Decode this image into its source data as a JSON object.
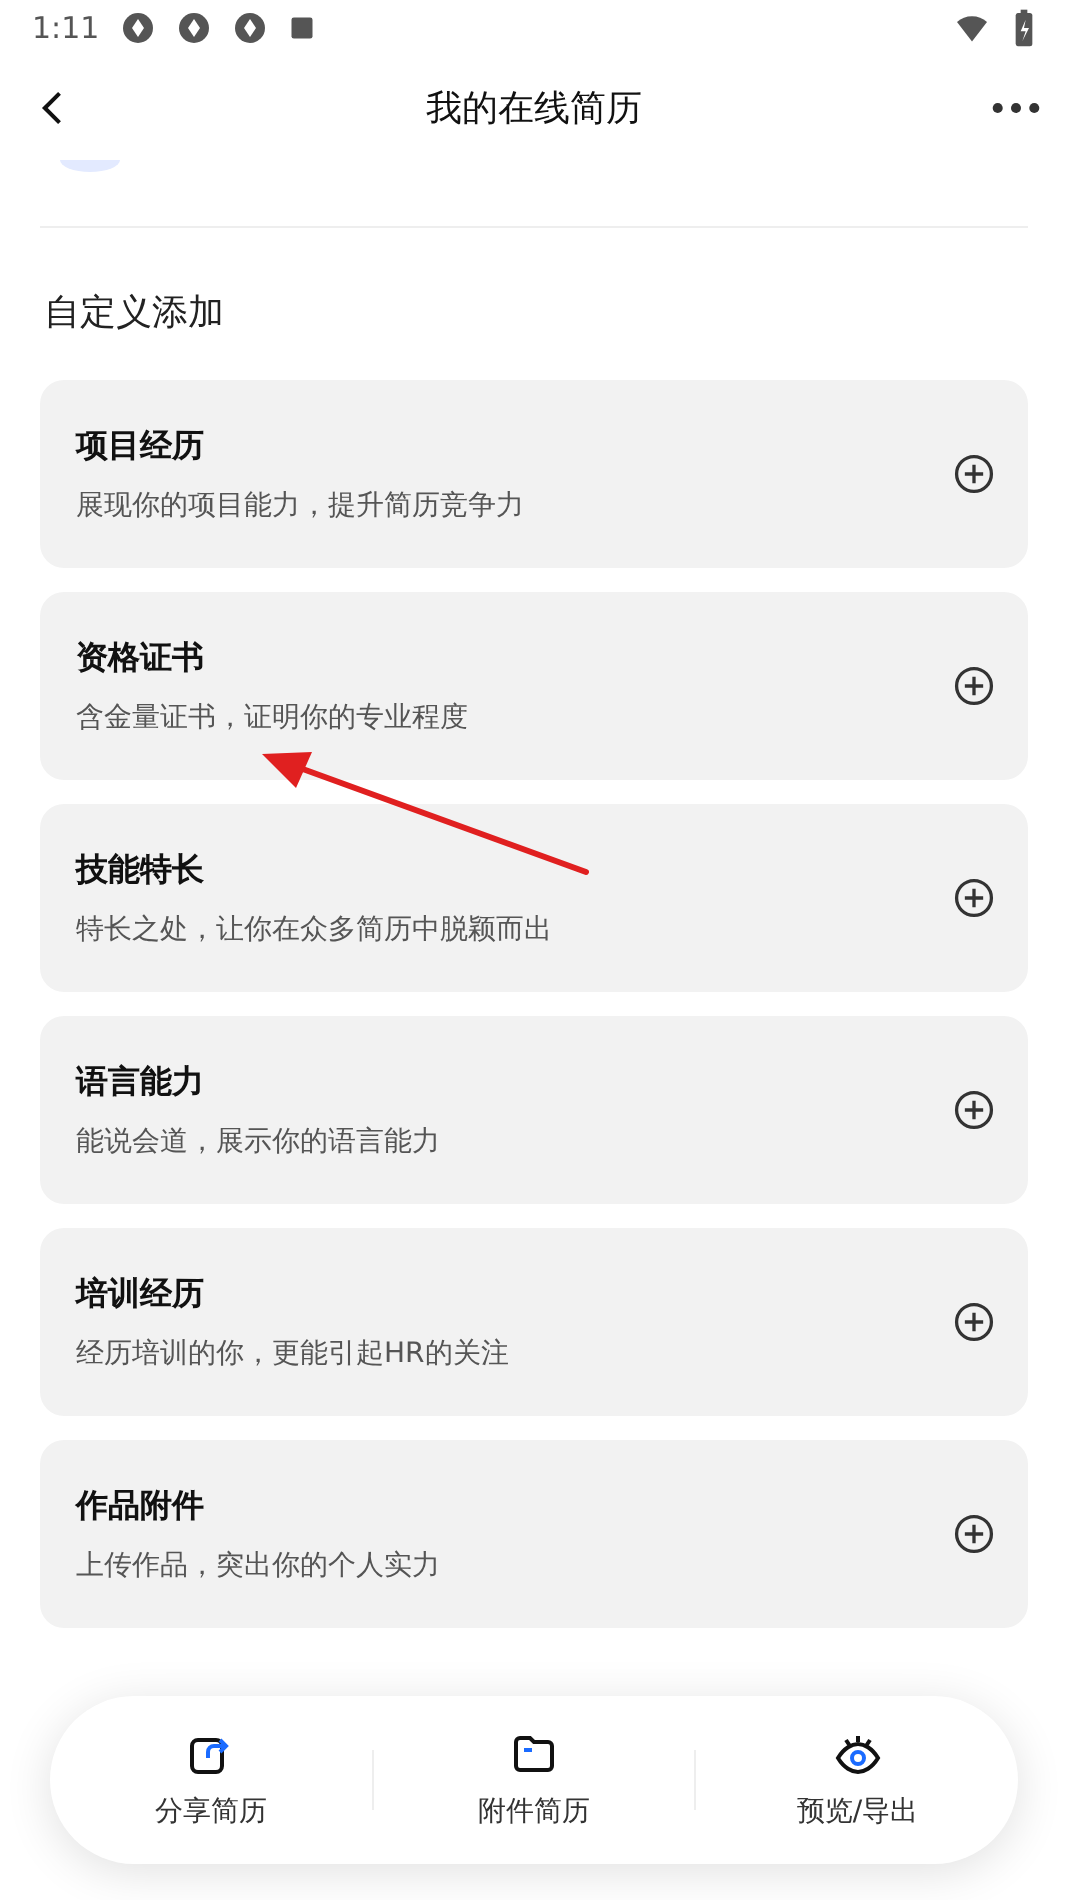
{
  "status_bar": {
    "time": "1:11"
  },
  "header": {
    "title": "我的在线简历"
  },
  "section": {
    "title": "自定义添加"
  },
  "items": [
    {
      "title": "项目经历",
      "subtitle": "展现你的项目能力，提升简历竞争力"
    },
    {
      "title": "资格证书",
      "subtitle": "含金量证书，证明你的专业程度"
    },
    {
      "title": "技能特长",
      "subtitle": "特长之处，让你在众多简历中脱颖而出"
    },
    {
      "title": "语言能力",
      "subtitle": "能说会道，展示你的语言能力"
    },
    {
      "title": "培训经历",
      "subtitle": "经历培训的你，更能引起HR的关注"
    },
    {
      "title": "作品附件",
      "subtitle": "上传作品，突出你的个人实力"
    }
  ],
  "bottom_bar": [
    {
      "kind": "share",
      "label": "分享简历"
    },
    {
      "kind": "folder",
      "label": "附件简历"
    },
    {
      "kind": "eye",
      "label": "预览/导出"
    }
  ]
}
